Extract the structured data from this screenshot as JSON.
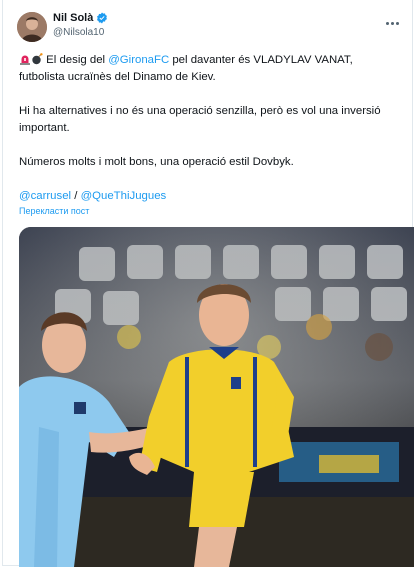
{
  "author": {
    "name": "Nil Solà",
    "handle": "@Nilsola10",
    "avatar_icon": "user-avatar",
    "verified_icon": "verified-badge-icon",
    "verified_color": "#1d9bf0"
  },
  "menu_icon": "more-options-icon",
  "tweet": {
    "line1_prefix": "El desig del ",
    "mention_club": "@GironaFC",
    "line1_suffix": " pel davanter és VLADYLAV VANAT, futbolista ucraïnès del Dinamo de Kiev.",
    "paragraph2": "Hi ha alternatives i no és una operació senzilla, però es vol una inversió important.",
    "paragraph3": "Números molts i molt bons, una operació estil Dovbyk.",
    "mention_a": "@carrusel",
    "separator": " / ",
    "mention_b": "@QueThiJugues",
    "emoji_1": "siren-icon",
    "emoji_2": "bomb-icon"
  },
  "translate_label": "Перекласти пост",
  "media": {
    "description_icon": "photo-image"
  },
  "colors": {
    "link": "#1d9bf0",
    "text": "#0f1419",
    "muted": "#536471"
  }
}
